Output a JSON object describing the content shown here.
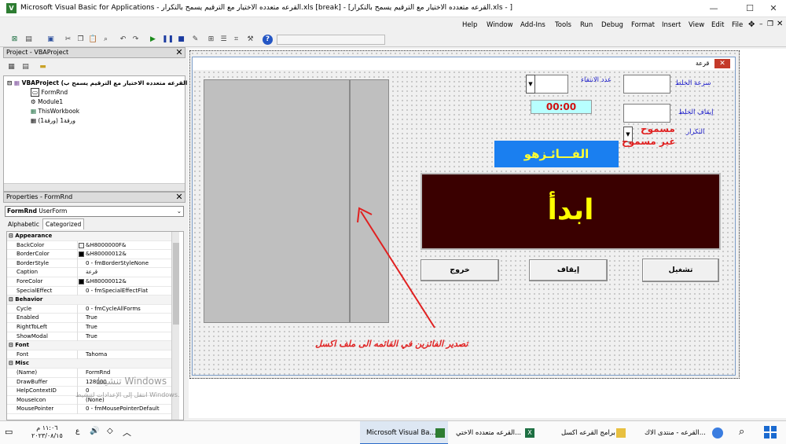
{
  "window": {
    "title": "Microsoft Visual Basic for Applications - القرعه متعدده الاختيار مع الترقيم يسمح بالتكرار.xls [break] - [القرعه متعدده الاختيار مع الترقيم يسمح بالتكرار.xls - ]",
    "minimize": "—",
    "maximize": "☐",
    "close": "✕"
  },
  "menu": [
    "Help",
    "Window",
    "Add-Ins",
    "Tools",
    "Run",
    "Debug",
    "Format",
    "Insert",
    "View",
    "Edit",
    "File"
  ],
  "project_panel": {
    "title": "Project - VBAProject",
    "root": "VBAProject (القرعه متعدده الاختيار مع الترقيم يسمح ب",
    "items": [
      "FormRnd",
      "Module1",
      "ThisWorkbook",
      "ورقة1 (ورقة1)"
    ]
  },
  "properties_panel": {
    "title": "Properties - FormRnd",
    "object_name": "FormRnd",
    "object_type": "UserForm",
    "tabs": [
      "Alphabetic",
      "Categorized"
    ],
    "rows": [
      {
        "kind": "cat",
        "name": "Appearance"
      },
      {
        "kind": "prop",
        "name": "BackColor",
        "value": "&H8000000F&",
        "swatch": "#f0f0f0"
      },
      {
        "kind": "prop",
        "name": "BorderColor",
        "value": "&H80000012&",
        "swatch": "#000000"
      },
      {
        "kind": "prop",
        "name": "BorderStyle",
        "value": "0 - fmBorderStyleNone"
      },
      {
        "kind": "prop",
        "name": "Caption",
        "value": "قرعة"
      },
      {
        "kind": "prop",
        "name": "ForeColor",
        "value": "&H80000012&",
        "swatch": "#000000"
      },
      {
        "kind": "prop",
        "name": "SpecialEffect",
        "value": "0 - fmSpecialEffectFlat"
      },
      {
        "kind": "cat",
        "name": "Behavior"
      },
      {
        "kind": "prop",
        "name": "Cycle",
        "value": "0 - fmCycleAllForms"
      },
      {
        "kind": "prop",
        "name": "Enabled",
        "value": "True"
      },
      {
        "kind": "prop",
        "name": "RightToLeft",
        "value": "True"
      },
      {
        "kind": "prop",
        "name": "ShowModal",
        "value": "True"
      },
      {
        "kind": "cat",
        "name": "Font"
      },
      {
        "kind": "prop",
        "name": "Font",
        "value": "Tahoma"
      },
      {
        "kind": "cat",
        "name": "Misc"
      },
      {
        "kind": "prop",
        "name": "(Name)",
        "value": "FormRnd"
      },
      {
        "kind": "prop",
        "name": "DrawBuffer",
        "value": "128000"
      },
      {
        "kind": "prop",
        "name": "HelpContextID",
        "value": "0"
      },
      {
        "kind": "prop",
        "name": "MouseIcon",
        "value": "(None)"
      },
      {
        "kind": "prop",
        "name": "MousePointer",
        "value": "0 - fmMousePointerDefault"
      }
    ]
  },
  "form": {
    "caption": "قرعة",
    "labels": {
      "speed": "سرعة الخلط",
      "count": "عدد الانتقاء",
      "stop": "إيقاف الخلط",
      "repeat": "التكرار",
      "allowed": "مسموح",
      "not_allowed": "غير مسموح"
    },
    "timer": "00:00",
    "winner_label": "الفـــائـزهو",
    "start_label": "ابدأ",
    "buttons": {
      "run": "تشغيل",
      "stop": "إيقاف",
      "exit": "خروج"
    },
    "annotation": "تصدير الفائزين في القائمه الى ملف اكسل"
  },
  "watermark": {
    "line1": "تنشيط Windows",
    "line2": "انتقل إلى الإعدادات لتنشيط Windows."
  },
  "taskbar": {
    "items": [
      "Microsoft Visual Ba...",
      "القرعه متعدده الاختي...",
      "برامج القرعه اكسل",
      "القرعه - منتدى الاك..."
    ],
    "time": "١١:٠٦ م",
    "date": "٢٠٢٣/٠٨/١٥",
    "lang": "ع"
  },
  "colors": {
    "winner_bg": "#1a7ff0",
    "winner_fg": "#ffff33",
    "start_bg": "#3a0000",
    "start_fg": "#ffff00",
    "timer_bg": "#b8ffff",
    "timer_fg": "#d01010",
    "annotation": "#e02020"
  }
}
